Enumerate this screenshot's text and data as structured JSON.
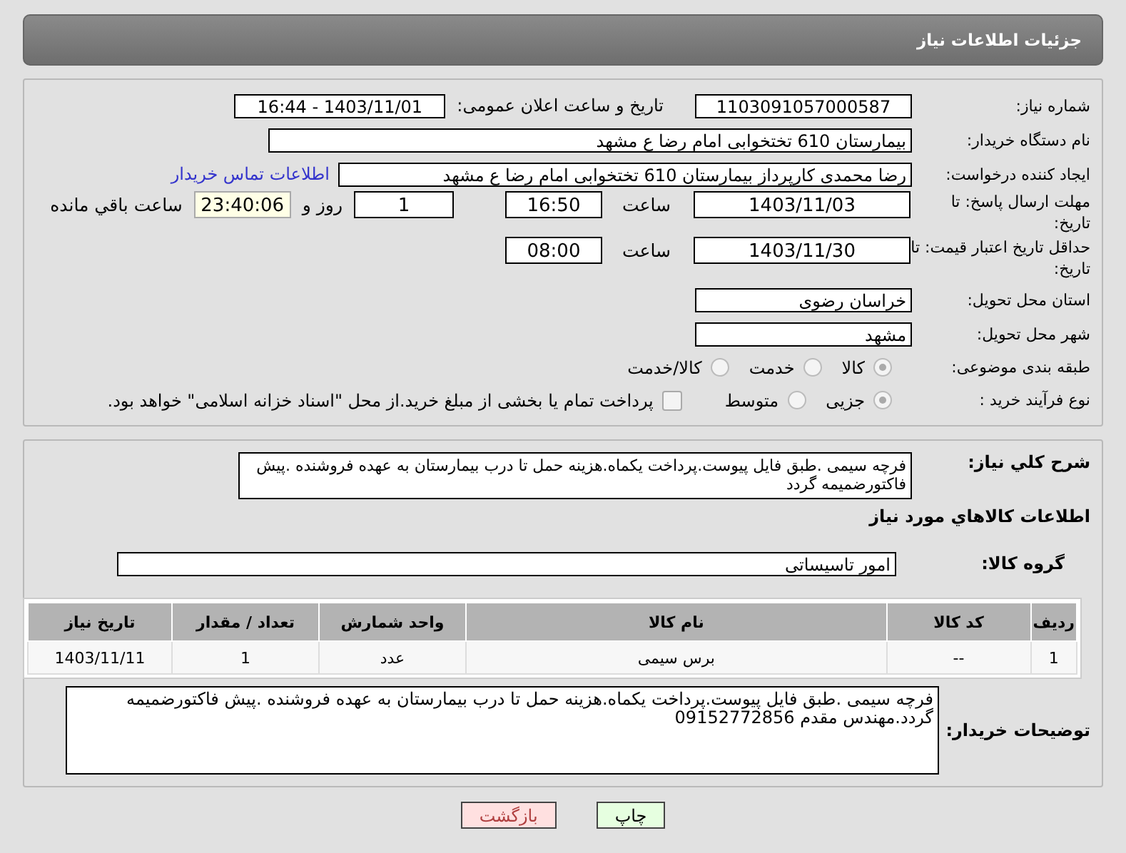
{
  "header": {
    "title": "جزئیات اطلاعات نیاز"
  },
  "need_number": {
    "label": "شماره نیاز:",
    "value": "1103091057000587"
  },
  "announce": {
    "label": "تاریخ و ساعت اعلان عمومی:",
    "value": "1403/11/01 - 16:44"
  },
  "buyer_org": {
    "label": "نام دستگاه خریدار:",
    "value": "بیمارستان 610 تختخوابی امام رضا ع  مشهد"
  },
  "creator": {
    "label": "ایجاد کننده درخواست:",
    "value": "رضا محمدی کارپرداز بیمارستان 610 تختخوابی امام رضا ع  مشهد",
    "link": "اطلاعات تماس خریدار"
  },
  "reply_deadline": {
    "label": "مهلت ارسال پاسخ: تا تاریخ:",
    "date": "1403/11/03",
    "time_label": "ساعت",
    "time": "16:50",
    "days": "1",
    "days_label": "روز و",
    "remaining": "23:40:06",
    "remaining_label": "ساعت باقي مانده"
  },
  "price_validity": {
    "label": "حداقل تاریخ اعتبار قیمت: تا تاریخ:",
    "date": "1403/11/30",
    "time_label": "ساعت",
    "time": "08:00"
  },
  "province": {
    "label": "استان محل تحویل:",
    "value": "خراسان رضوی"
  },
  "city": {
    "label": "شهر محل تحویل:",
    "value": "مشهد"
  },
  "category": {
    "label": "طبقه بندی موضوعی:",
    "options": [
      {
        "label": "کالا",
        "selected": true
      },
      {
        "label": "خدمت",
        "selected": false
      },
      {
        "label": "کالا/خدمت",
        "selected": false
      }
    ]
  },
  "process": {
    "label": "نوع فرآیند خرید :",
    "options": [
      {
        "label": "جزیی",
        "selected": true
      },
      {
        "label": "متوسط",
        "selected": false
      }
    ],
    "treasury": {
      "label": "پرداخت تمام یا بخشی از مبلغ خرید.از محل \"اسناد خزانه اسلامی\" خواهد بود.",
      "checked": false
    }
  },
  "description": {
    "label": "شرح کلي نیاز:",
    "value": "فرچه سیمی .طبق فایل پیوست.پرداخت یکماه.هزینه حمل تا درب بیمارستان به عهده فروشنده .پیش فاکتورضمیمه گردد"
  },
  "goods_title": "اطلاعات کالاهاي مورد نیاز",
  "goods_group": {
    "label": "گروه کالا:",
    "value": "امور تاسیساتی"
  },
  "table": {
    "columns": [
      "ردیف",
      "کد کالا",
      "نام کالا",
      "واحد شمارش",
      "تعداد / مقدار",
      "تاریخ نیاز"
    ],
    "rows": [
      [
        "1",
        "--",
        "برس سیمی",
        "عدد",
        "1",
        "1403/11/11"
      ]
    ]
  },
  "buyer_notes": {
    "label": "توضیحات خریدار:",
    "value": "فرچه سیمی .طبق فایل پیوست.پرداخت یکماه.هزینه حمل تا درب بیمارستان به عهده فروشنده .پیش فاکتورضمیمه گردد.مهندس مقدم 09152772856"
  },
  "buttons": [
    {
      "label": "چاپ",
      "kind": "print"
    },
    {
      "label": "بازگشت",
      "kind": "back"
    }
  ]
}
